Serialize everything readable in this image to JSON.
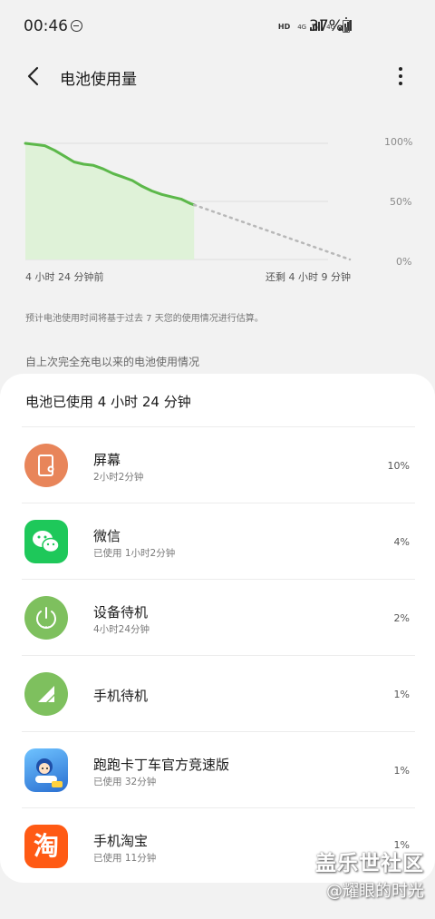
{
  "status_bar": {
    "time": "00:46",
    "hd": "HD",
    "net1": "4G",
    "net2": "4G",
    "battery": "37%"
  },
  "header": {
    "title": "电池使用量",
    "back_icon": "back-arrow-icon",
    "more_icon": "more-vertical-icon"
  },
  "chart_data": {
    "type": "area",
    "y_ticks": [
      "100%",
      "50%",
      "0%"
    ],
    "ylim": [
      0,
      100
    ],
    "x_start_label": "4 小时 24 分钟前",
    "x_end_label": "还剩 4 小时 9 分钟",
    "colors": {
      "actual": "#5cb84a",
      "fill": "#dff2d8",
      "predicted": "#b8b8b8",
      "grid": "#dedede"
    },
    "actual": [
      {
        "t": 0.0,
        "level": 100
      },
      {
        "t": 0.03,
        "level": 99
      },
      {
        "t": 0.06,
        "level": 98
      },
      {
        "t": 0.09,
        "level": 94
      },
      {
        "t": 0.12,
        "level": 89
      },
      {
        "t": 0.15,
        "level": 84
      },
      {
        "t": 0.18,
        "level": 82
      },
      {
        "t": 0.21,
        "level": 81
      },
      {
        "t": 0.24,
        "level": 78
      },
      {
        "t": 0.27,
        "level": 74
      },
      {
        "t": 0.3,
        "level": 71
      },
      {
        "t": 0.33,
        "level": 68
      },
      {
        "t": 0.36,
        "level": 63
      },
      {
        "t": 0.39,
        "level": 59
      },
      {
        "t": 0.42,
        "level": 56
      },
      {
        "t": 0.45,
        "level": 54
      },
      {
        "t": 0.48,
        "level": 52
      },
      {
        "t": 0.51,
        "level": 48
      },
      {
        "t": 0.52,
        "level": 47
      }
    ],
    "predicted": [
      {
        "t": 0.52,
        "level": 47
      },
      {
        "t": 1.0,
        "level": 0
      }
    ]
  },
  "note": "预计电池使用时间将基于过去 7 天您的使用情况进行估算。",
  "section_title": "自上次完全充电以来的电池使用情况",
  "usage": {
    "summary": "电池已使用 4 小时 24 分钟",
    "apps": [
      {
        "name": "屏幕",
        "sub": "2小时2分钟",
        "pct": "10%",
        "icon": "screen-icon",
        "color": "#e8855a"
      },
      {
        "name": "微信",
        "sub": "已使用 1小时2分钟",
        "pct": "4%",
        "icon": "wechat-icon",
        "color": "#1ec85a"
      },
      {
        "name": "设备待机",
        "sub": "4小时24分钟",
        "pct": "2%",
        "icon": "power-icon",
        "color": "#7ec05e"
      },
      {
        "name": "手机待机",
        "sub": "",
        "pct": "1%",
        "icon": "signal-icon",
        "color": "#7ec05e"
      },
      {
        "name": "跑跑卡丁车官方竞速版",
        "sub": "已使用 32分钟",
        "pct": "1%",
        "icon": "kartrider-icon",
        "color": "#3a86e0"
      },
      {
        "name": "手机淘宝",
        "sub": "已使用 11分钟",
        "pct": "1%",
        "icon": "taobao-icon",
        "color": "#ff5a14",
        "glyph": "淘"
      }
    ]
  },
  "watermark": {
    "top": "盖乐世社区",
    "bottom": "@耀眼的时光"
  }
}
